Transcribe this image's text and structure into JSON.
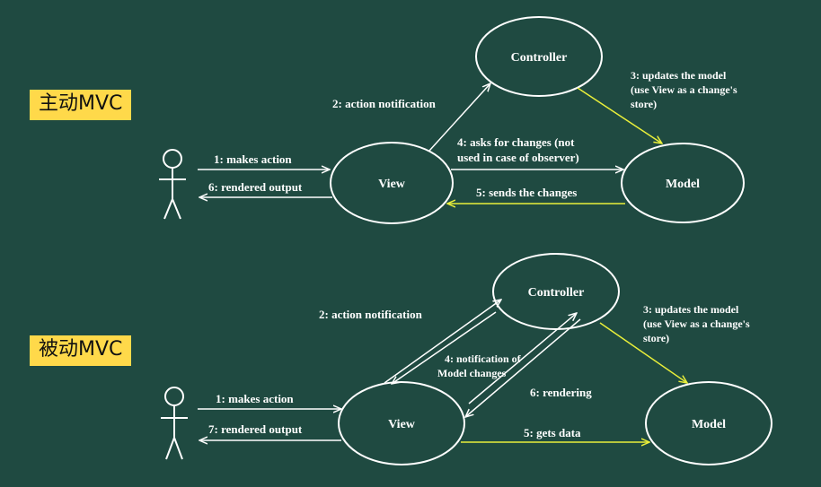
{
  "active": {
    "badge": "主动MVC",
    "nodes": {
      "controller": "Controller",
      "view": "View",
      "model": "Model"
    },
    "edges": {
      "makes_action": "1: makes action",
      "action_notification": "2: action notification",
      "updates_model": [
        "3: updates the model",
        "(use View as a change's",
        "store)"
      ],
      "asks_changes": [
        "4: asks for changes (not",
        "used in case of observer)"
      ],
      "sends_changes": "5: sends the changes",
      "rendered_output": "6: rendered output"
    }
  },
  "passive": {
    "badge": "被动MVC",
    "nodes": {
      "controller": "Controller",
      "view": "View",
      "model": "Model"
    },
    "edges": {
      "makes_action": "1: makes action",
      "action_notification": "2: action notification",
      "updates_model": [
        "3: updates the model",
        "(use View as a change's",
        "store)"
      ],
      "notification_changes": [
        "4: notification of",
        "Model changes"
      ],
      "gets_data": "5: gets data",
      "rendering": "6: rendering",
      "rendered_output": "7: rendered output"
    }
  },
  "colors": {
    "background": "#1f4a41",
    "line": "#ffffff",
    "highlight": "#e9ef3a",
    "badge": "#ffd94a"
  }
}
